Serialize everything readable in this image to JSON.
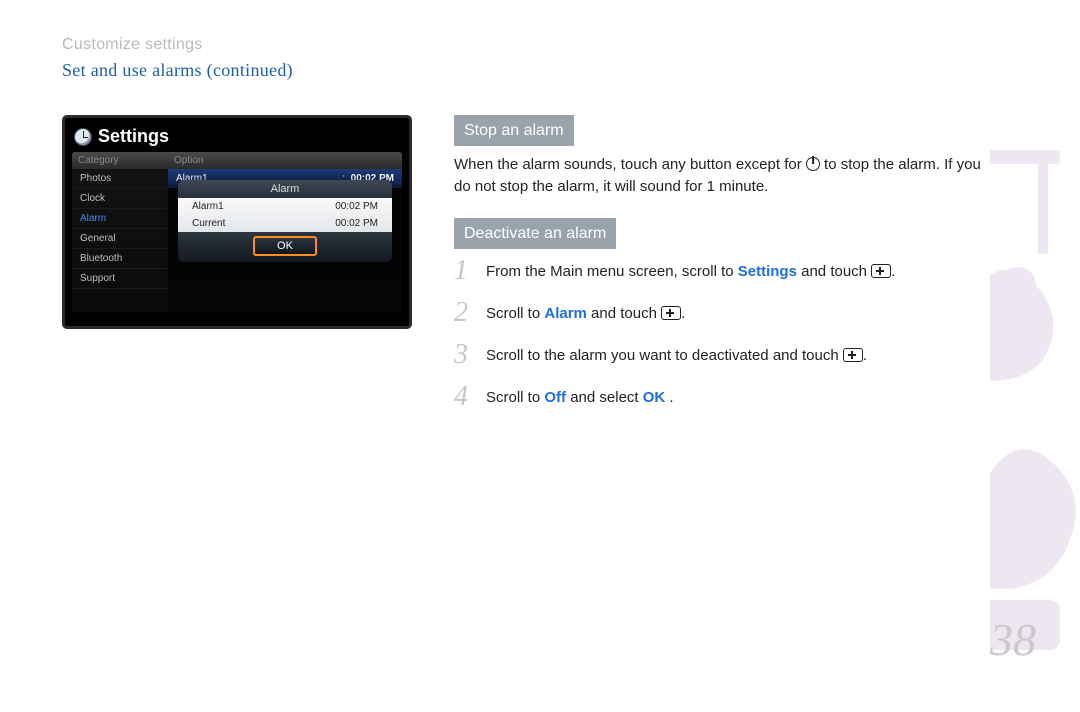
{
  "header": {
    "breadcrumb": "Customize settings",
    "section": "Set and use alarms  (continued)"
  },
  "device": {
    "title": "Settings",
    "sidebar": {
      "header": "Category",
      "items": [
        "Photos",
        "Clock",
        "Alarm",
        "General",
        "Bluetooth",
        "Support"
      ],
      "selected_index": 2
    },
    "options": {
      "header": "Option",
      "row_label": "Alarm1",
      "row_sep": ":",
      "row_time": "00:02 PM"
    },
    "popup": {
      "title": "Alarm",
      "rows": [
        {
          "label": "Alarm1",
          "value": "00:02  PM"
        },
        {
          "label": "Current",
          "value": "00:02  PM"
        }
      ],
      "ok": "OK"
    }
  },
  "content": {
    "stop": {
      "heading": "Stop an alarm",
      "text_before": "When the alarm sounds, touch any button except for ",
      "text_after": " to stop the alarm. If you do not stop the alarm, it will sound for 1 minute."
    },
    "deactivate": {
      "heading": "Deactivate an alarm",
      "steps": [
        {
          "n": "1",
          "pre": "From the Main menu screen, scroll to ",
          "kw": "Settings",
          "post": " and touch ",
          "glyph": true,
          "tail": "."
        },
        {
          "n": "2",
          "pre": "Scroll to ",
          "kw": "Alarm",
          "post": " and touch ",
          "glyph": true,
          "tail": "."
        },
        {
          "n": "3",
          "pre": "Scroll to the alarm you want to deactivated and touch ",
          "kw": "",
          "post": "",
          "glyph": true,
          "tail": "."
        },
        {
          "n": "4",
          "pre": "Scroll to ",
          "kw": "Off",
          "post": " and select ",
          "kw2": "OK",
          "tail": " ."
        }
      ]
    }
  },
  "page_number": "38"
}
